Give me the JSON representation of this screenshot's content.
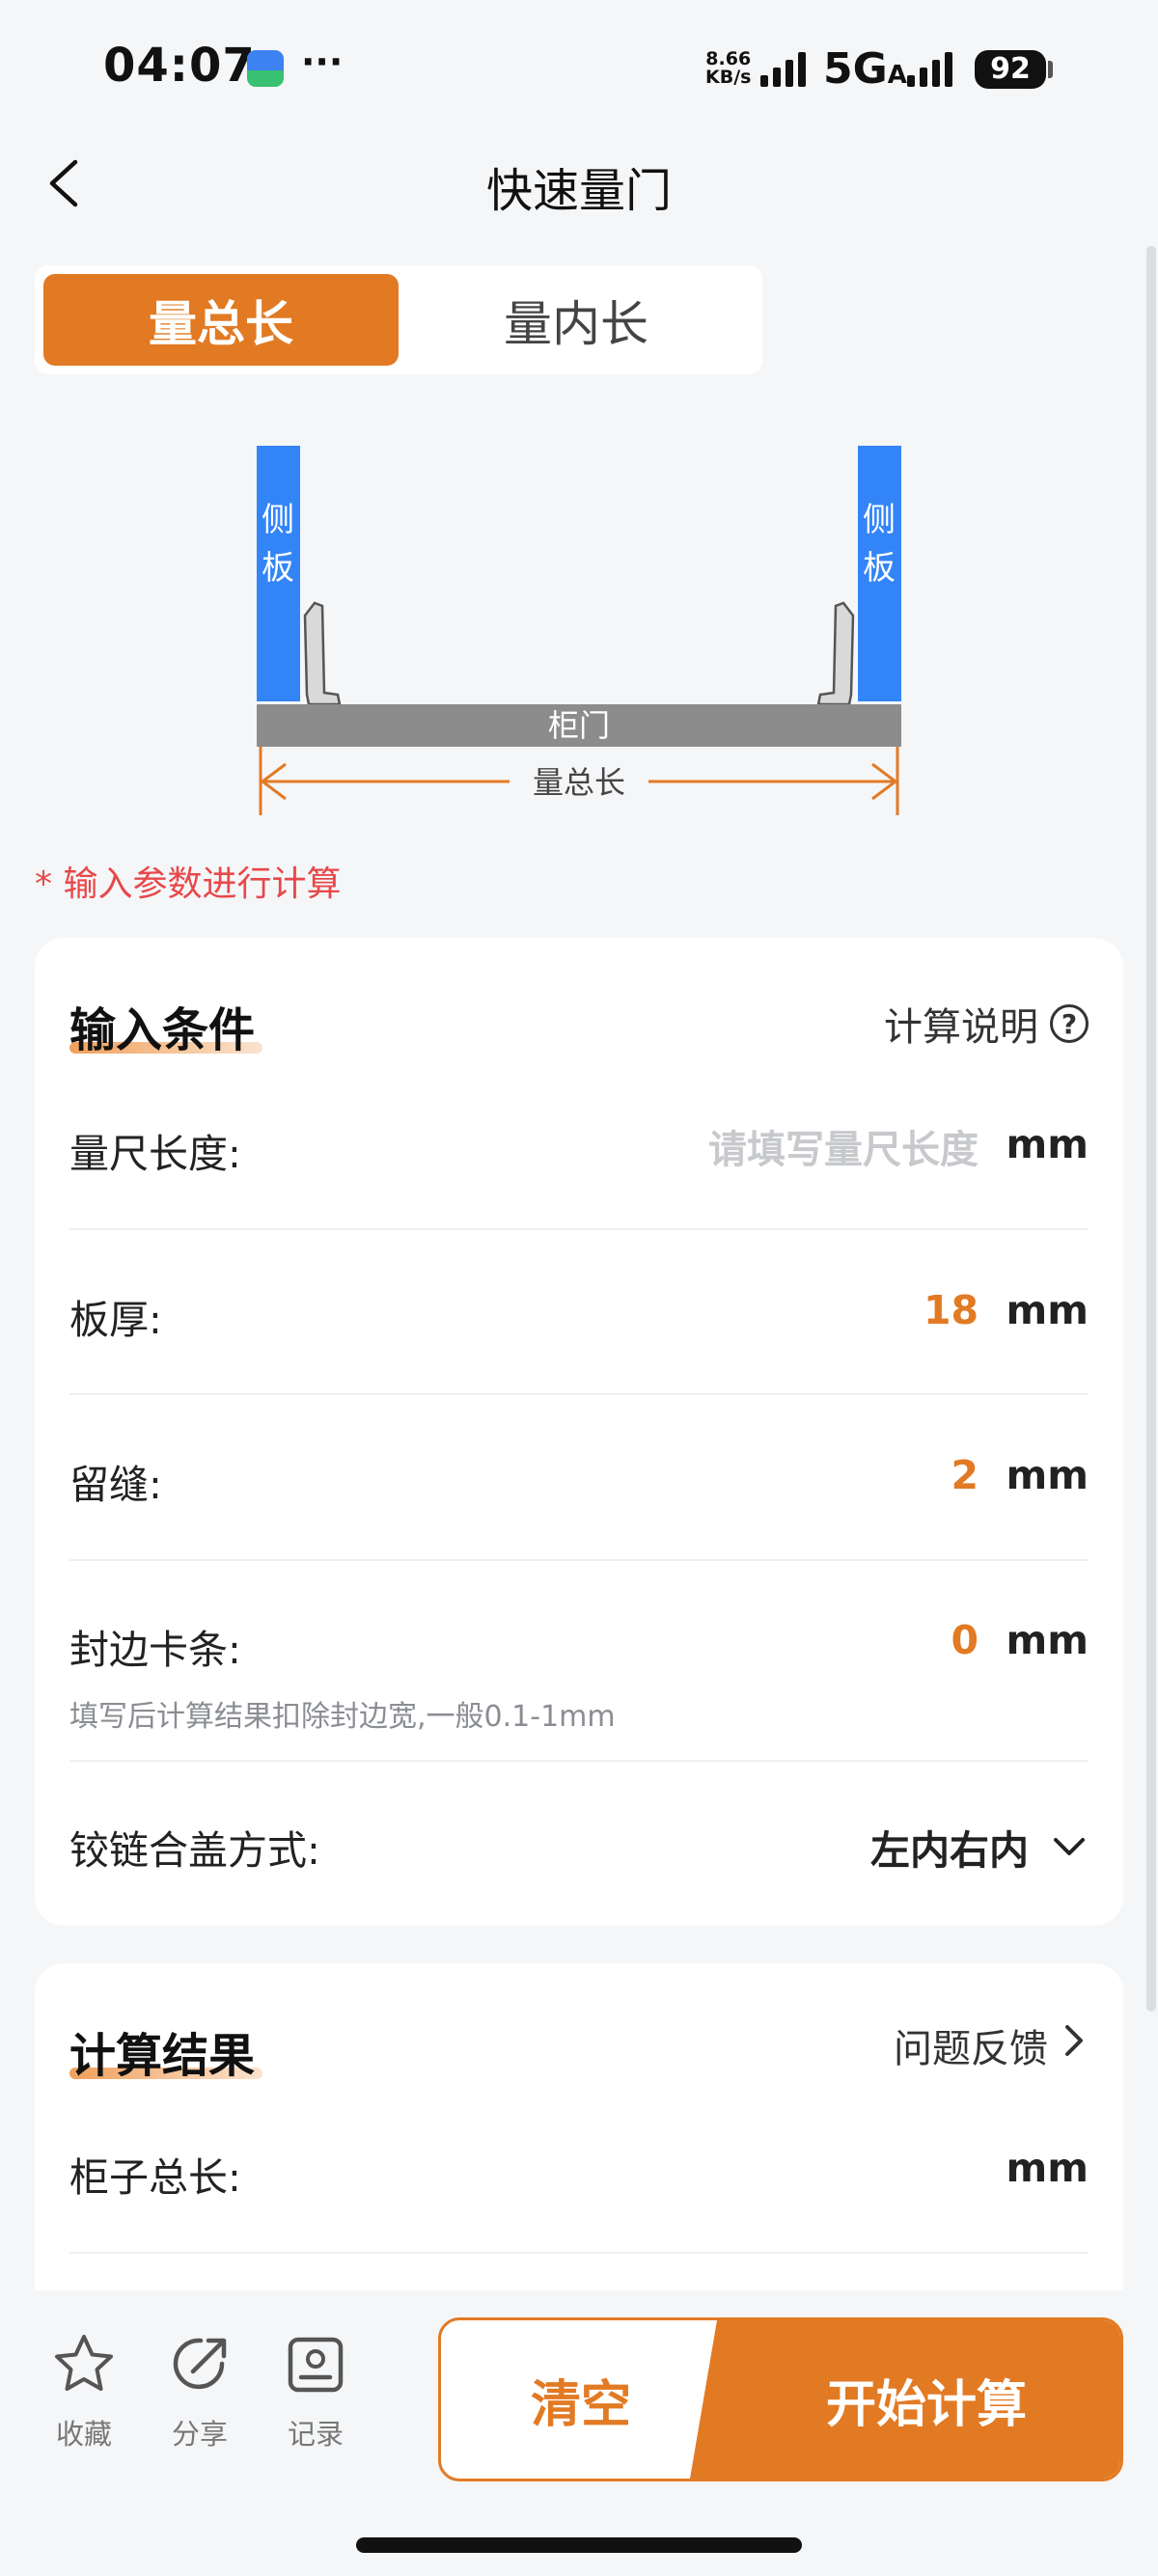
{
  "status_bar": {
    "time": "04:07",
    "dots": "···",
    "net_speed_value": "8.66",
    "net_speed_unit": "KB/s",
    "network": "5G",
    "network_suffix": "A",
    "battery": "92",
    "app_icon": "app-notification-icon"
  },
  "header": {
    "title": "快速量门",
    "back_icon": "chevron-left-icon"
  },
  "tabs": {
    "active": "量总长",
    "inactive": "量内长"
  },
  "diagram": {
    "left_panel": "侧板",
    "right_panel": "侧板",
    "door": "柜门",
    "dimension": "量总长",
    "colors": {
      "panel": "#3385f7",
      "door": "#8c8c8c",
      "dimension": "#e27a24"
    }
  },
  "hint": "* 输入参数进行计算",
  "input_section": {
    "title": "输入条件",
    "help_link": "计算说明",
    "help_icon_char": "?",
    "ruler": {
      "label": "量尺长度:",
      "placeholder": "请填写量尺长度",
      "value": "",
      "unit": "mm"
    },
    "thickness": {
      "label": "板厚:",
      "value": "18",
      "unit": "mm"
    },
    "gap": {
      "label": "留缝:",
      "value": "2",
      "unit": "mm"
    },
    "edge_strip": {
      "label": "封边卡条:",
      "value": "0",
      "unit": "mm",
      "note": "填写后计算结果扣除封边宽,一般0.1-1mm"
    },
    "hinge": {
      "label": "铰链合盖方式:",
      "selected": "左内右内"
    }
  },
  "result_section": {
    "title": "计算结果",
    "feedback_link": "问题反馈",
    "total_length": {
      "label": "柜子总长:",
      "value": "",
      "unit": "mm"
    }
  },
  "bottom_bar": {
    "favorite": "收藏",
    "share": "分享",
    "record": "记录",
    "clear": "清空",
    "start": "开始计算"
  },
  "colors": {
    "accent": "#e27a24",
    "hint": "#e8484a",
    "background": "#f5f6f8"
  }
}
